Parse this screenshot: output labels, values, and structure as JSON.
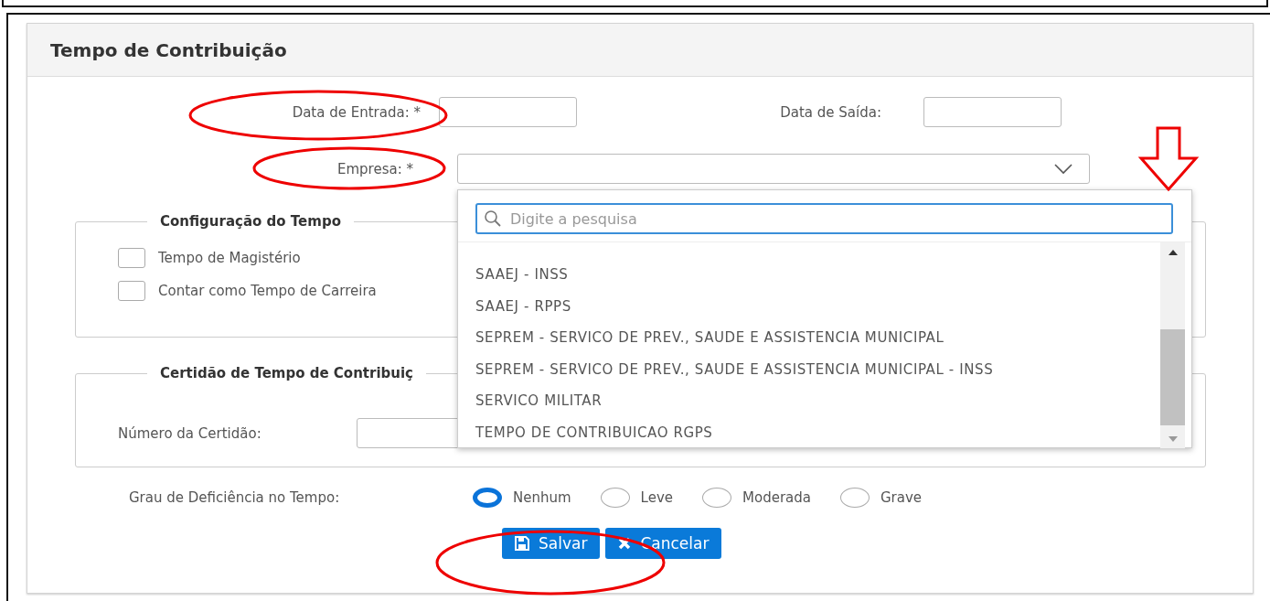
{
  "panel": {
    "title": "Tempo de Contribuição"
  },
  "fields": {
    "data_entrada": {
      "label": "Data de Entrada: *"
    },
    "data_saida": {
      "label": "Data de Saída:"
    },
    "empresa": {
      "label": "Empresa: *",
      "expanded": true
    }
  },
  "dropdown": {
    "search": {
      "placeholder": "Digite a pesquisa"
    },
    "options": [
      {
        "label": "SAAEJ - INSS"
      },
      {
        "label": "SAAEJ - RPPS"
      },
      {
        "label": "SEPREM - SERVICO DE PREV., SAUDE E ASSISTENCIA MUNICIPAL"
      },
      {
        "label": "SEPREM - SERVICO DE PREV., SAUDE E ASSISTENCIA MUNICIPAL - INSS"
      },
      {
        "label": "SERVICO MILITAR"
      },
      {
        "label": "TEMPO DE CONTRIBUICAO RGPS"
      }
    ]
  },
  "config_tempo": {
    "legend": "Configuração do Tempo",
    "checkboxes": [
      {
        "label": "Tempo de Magistério",
        "checked": false
      },
      {
        "label": "Contar como Tempo de Carreira",
        "checked": false
      }
    ]
  },
  "certidao": {
    "legend": "Certidão de Tempo de Contribuiç",
    "numero_label": "Número da Certidão:"
  },
  "deficiencia": {
    "label": "Grau de Deficiência no Tempo:",
    "options": [
      {
        "label": "Nenhum",
        "selected": true
      },
      {
        "label": "Leve",
        "selected": false
      },
      {
        "label": "Moderada",
        "selected": false
      },
      {
        "label": "Grave",
        "selected": false
      }
    ]
  },
  "buttons": [
    {
      "label": "Salvar",
      "kind": "save"
    },
    {
      "label": "Cancelar",
      "kind": "cancel"
    }
  ]
}
